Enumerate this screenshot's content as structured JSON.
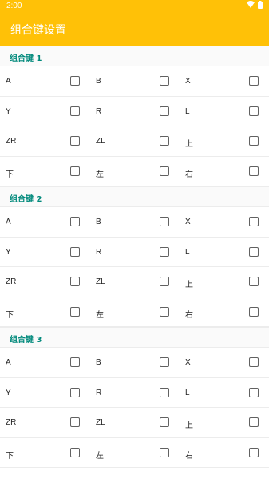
{
  "status": {
    "time": "2:00",
    "icons": [
      "wifi-icon",
      "battery-icon"
    ]
  },
  "appbar": {
    "title": "组合键设置",
    "color": "#ffc107"
  },
  "groups": [
    {
      "title": "组合键 1",
      "rows": [
        [
          "A",
          "B",
          "X"
        ],
        [
          "Y",
          "R",
          "L"
        ],
        [
          "ZR",
          "ZL",
          "上"
        ],
        [
          "下",
          "左",
          "右"
        ]
      ]
    },
    {
      "title": "组合键 2",
      "rows": [
        [
          "A",
          "B",
          "X"
        ],
        [
          "Y",
          "R",
          "L"
        ],
        [
          "ZR",
          "ZL",
          "上"
        ],
        [
          "下",
          "左",
          "右"
        ]
      ]
    },
    {
      "title": "组合键 3",
      "rows": [
        [
          "A",
          "B",
          "X"
        ],
        [
          "Y",
          "R",
          "L"
        ],
        [
          "ZR",
          "ZL",
          "上"
        ],
        [
          "下",
          "左",
          "右"
        ]
      ]
    }
  ],
  "accent": "#00897b"
}
